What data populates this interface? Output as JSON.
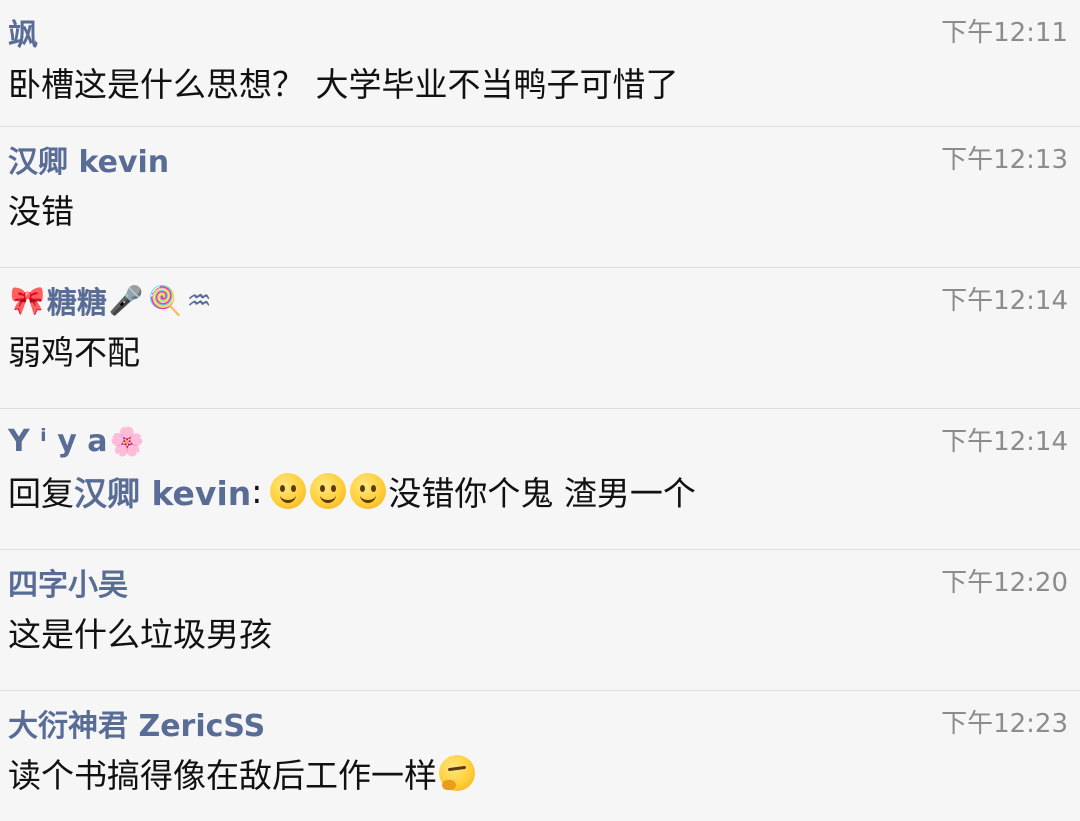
{
  "comments": [
    {
      "author": "飒",
      "time": "下午12:11",
      "text": "卧槽这是什么思想？ 大学毕业不当鸭子可惜了"
    },
    {
      "author": "汉卿 kevin",
      "time": "下午12:13",
      "text": "没错"
    },
    {
      "author_prefix_emoji": "🎀",
      "author": "糖糖",
      "author_suffix_emojis": [
        "🎤",
        "🍭",
        "♒"
      ],
      "time": "下午12:14",
      "text": "弱鸡不配"
    },
    {
      "author": "Y ⁱ y a",
      "author_suffix_emoji": "🌸",
      "time": "下午12:14",
      "reply_prefix": "回复",
      "reply_target": "汉卿 kevin",
      "reply_colon": ":",
      "reply_emojis": [
        "smile-face",
        "smile-face",
        "smile-face"
      ],
      "text": "没错你个鬼 渣男一个"
    },
    {
      "author": "四字小吴",
      "time": "下午12:20",
      "text": "这是什么垃圾男孩"
    },
    {
      "author": "大衍神君 ZericSS",
      "time": "下午12:23",
      "text": "读个书搞得像在敌后工作一样",
      "text_suffix_emoji": "thinking-face"
    }
  ],
  "colors": {
    "background": "#f6f6f6",
    "author": "#586c96",
    "time": "#8c8c8c",
    "text": "#111111",
    "divider": "#dddddd"
  }
}
